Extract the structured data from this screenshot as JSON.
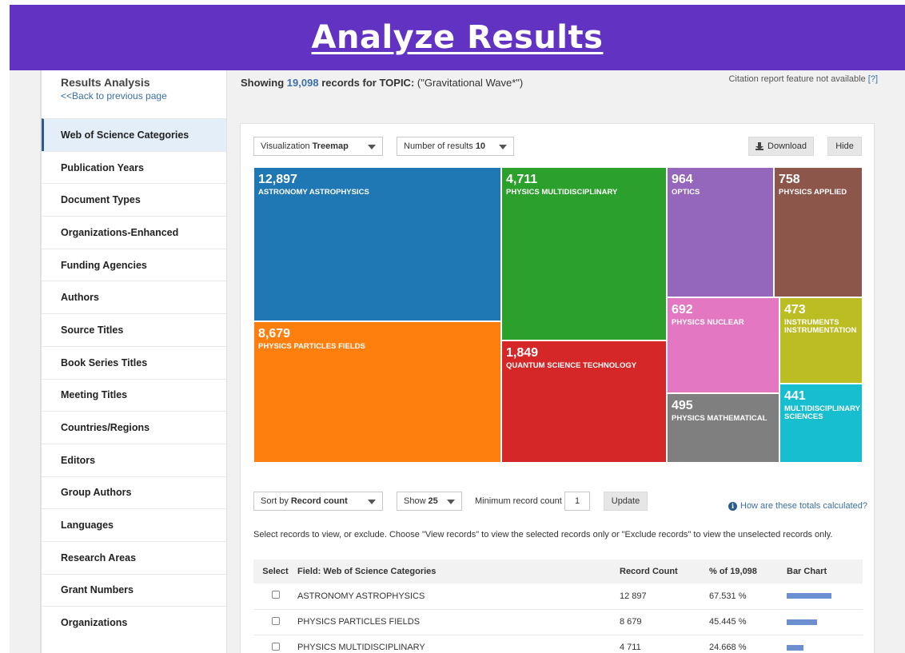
{
  "banner": {
    "title": "Analyze Results"
  },
  "sidebar": {
    "title": "Results Analysis",
    "back_link": "<<Back to previous page",
    "items": [
      {
        "label": "Web of Science Categories"
      },
      {
        "label": "Publication Years"
      },
      {
        "label": "Document Types"
      },
      {
        "label": "Organizations-Enhanced"
      },
      {
        "label": "Funding Agencies"
      },
      {
        "label": "Authors"
      },
      {
        "label": "Source Titles"
      },
      {
        "label": "Book Series Titles"
      },
      {
        "label": "Meeting Titles"
      },
      {
        "label": "Countries/Regions"
      },
      {
        "label": "Editors"
      },
      {
        "label": "Group Authors"
      },
      {
        "label": "Languages"
      },
      {
        "label": "Research Areas"
      },
      {
        "label": "Grant Numbers"
      },
      {
        "label": "Organizations"
      }
    ]
  },
  "header": {
    "showing": "Showing",
    "count": "19,098",
    "records_for": "records for",
    "topic_label": "TOPIC:",
    "topic_query": "(\"Gravitational Wave*\")",
    "citation_note": "Citation report feature not available",
    "citation_help": "[?]"
  },
  "controls": {
    "visualization_label": "Visualization",
    "visualization_value": "Treemap",
    "results_label": "Number of results",
    "results_value": "10",
    "download": "Download",
    "hide": "Hide",
    "sort_label": "Sort by",
    "sort_value": "Record count",
    "show_label": "Show",
    "show_value": "25",
    "min_label": "Minimum record count",
    "min_value": "1",
    "update": "Update",
    "how_link": "How are these totals calculated?",
    "help_text": "Select records to view, or exclude. Choose \"View records\" to view the selected records only or \"Exclude records\" to view the unselected records only."
  },
  "chart_data": {
    "type": "treemap",
    "items": [
      {
        "label": "ASTRONOMY ASTROPHYSICS",
        "value": 12897,
        "display": "12,897",
        "color": "#1f77b4"
      },
      {
        "label": "PHYSICS PARTICLES FIELDS",
        "value": 8679,
        "display": "8,679",
        "color": "#ff7f0e"
      },
      {
        "label": "PHYSICS MULTIDISCIPLINARY",
        "value": 4711,
        "display": "4,711",
        "color": "#2ca02c"
      },
      {
        "label": "QUANTUM SCIENCE TECHNOLOGY",
        "value": 1849,
        "display": "1,849",
        "color": "#d62728"
      },
      {
        "label": "OPTICS",
        "value": 964,
        "display": "964",
        "color": "#9467bd"
      },
      {
        "label": "PHYSICS APPLIED",
        "value": 758,
        "display": "758",
        "color": "#8c564b"
      },
      {
        "label": "PHYSICS NUCLEAR",
        "value": 692,
        "display": "692",
        "color": "#e377c2"
      },
      {
        "label": "PHYSICS MATHEMATICAL",
        "value": 495,
        "display": "495",
        "color": "#7f7f7f"
      },
      {
        "label": "INSTRUMENTS INSTRUMENTATION",
        "value": 473,
        "display": "473",
        "color": "#bcbd22"
      },
      {
        "label": "MULTIDISCIPLINARY SCIENCES",
        "value": 441,
        "display": "441",
        "color": "#17becf"
      }
    ]
  },
  "table": {
    "headers": [
      "Select",
      "Field: Web of Science Categories",
      "Record Count",
      "% of 19,098",
      "Bar Chart"
    ],
    "rows": [
      {
        "field": "ASTRONOMY ASTROPHYSICS",
        "count": "12 897",
        "percent": "67.531 %",
        "pct": 67.531
      },
      {
        "field": "PHYSICS PARTICLES FIELDS",
        "count": "8 679",
        "percent": "45.445 %",
        "pct": 45.445
      },
      {
        "field": "PHYSICS MULTIDISCIPLINARY",
        "count": "4 711",
        "percent": "24.668 %",
        "pct": 24.668
      }
    ]
  }
}
